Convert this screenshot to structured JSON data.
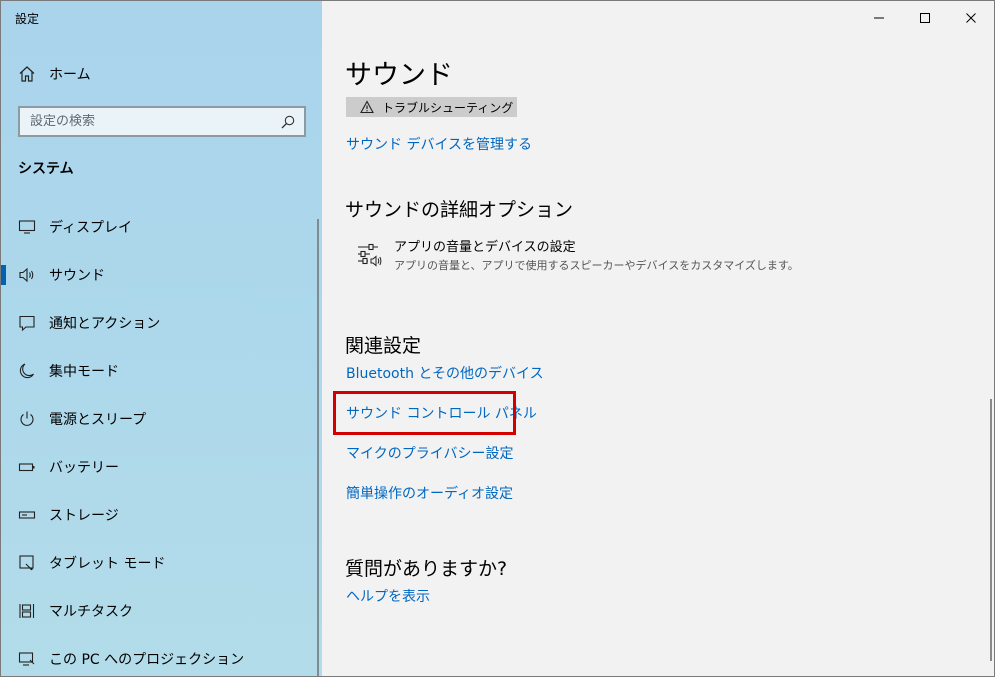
{
  "window": {
    "title": "設定"
  },
  "sidebar": {
    "home_label": "ホーム",
    "search_placeholder": "設定の検索",
    "section_title": "システム",
    "items": [
      {
        "label": "ディスプレイ",
        "icon": "display-icon"
      },
      {
        "label": "サウンド",
        "icon": "speaker-icon",
        "active": true
      },
      {
        "label": "通知とアクション",
        "icon": "notification-icon"
      },
      {
        "label": "集中モード",
        "icon": "moon-icon"
      },
      {
        "label": "電源とスリープ",
        "icon": "power-icon"
      },
      {
        "label": "バッテリー",
        "icon": "battery-icon"
      },
      {
        "label": "ストレージ",
        "icon": "storage-icon"
      },
      {
        "label": "タブレット モード",
        "icon": "tablet-icon"
      },
      {
        "label": "マルチタスク",
        "icon": "multitask-icon"
      },
      {
        "label": "この PC へのプロジェクション",
        "icon": "projection-icon"
      }
    ]
  },
  "main": {
    "title": "サウンド",
    "troubleshoot_label": "トラブルシューティング",
    "manage_devices_link": "サウンド デバイスを管理する",
    "advanced": {
      "heading": "サウンドの詳細オプション",
      "app_volume_title": "アプリの音量とデバイスの設定",
      "app_volume_desc": "アプリの音量と、アプリで使用するスピーカーやデバイスをカスタマイズします。"
    },
    "related": {
      "heading": "関連設定",
      "links": [
        "Bluetooth とその他のデバイス",
        "サウンド コントロール パネル",
        "マイクのプライバシー設定",
        "簡単操作のオーディオ設定"
      ]
    },
    "questions": {
      "heading": "質問がありますか?",
      "help_link": "ヘルプを表示"
    }
  },
  "colors": {
    "accent": "#0063b1",
    "link": "#0067c0",
    "highlight_box": "#d40000",
    "sidebar_bg": "#add8eb",
    "content_bg": "#f2f2f2"
  }
}
